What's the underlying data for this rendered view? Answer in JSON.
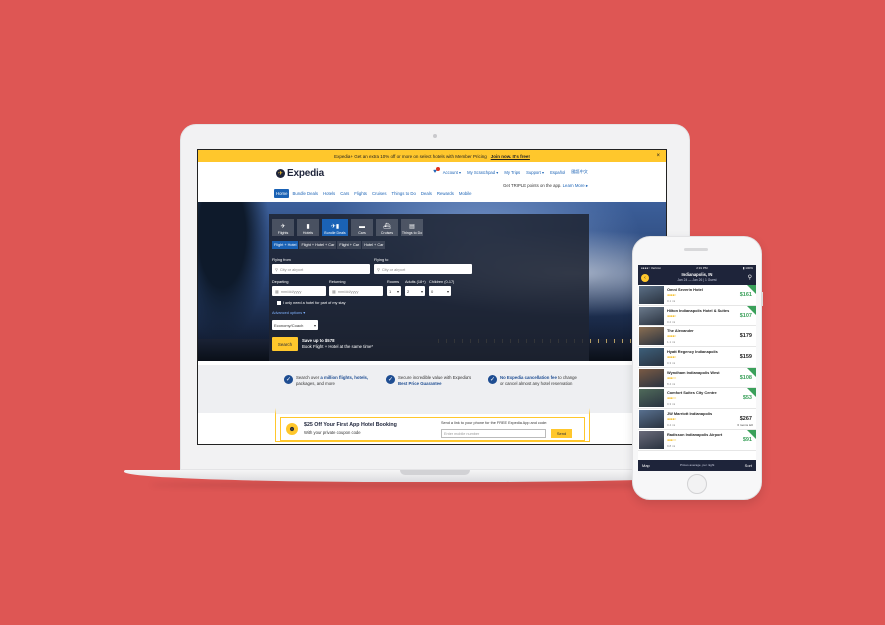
{
  "colors": {
    "background": "#de5654",
    "brand_navy": "#1e243a",
    "brand_yellow": "#ffc72c",
    "link_blue": "#1a62b5",
    "deal_green": "#3aa05a"
  },
  "laptop": {
    "promo_bar": {
      "text": "Expedia+  Get an extra 10% off or more on select hotels with Member Pricing",
      "link": "Join now. It's free!",
      "close": "×"
    },
    "logo": {
      "mark": "✈",
      "text": "Expedia"
    },
    "top_links": {
      "notification_icon": "bell-icon",
      "account": "Account ▾",
      "scratchpad": "My Scratchpad ▾",
      "trips": "My Trips",
      "support": "Support ▾",
      "lang1": "Español",
      "lang2": "國語中文"
    },
    "app_note": {
      "text": "Get TRIPLE points on the app.",
      "link": "Learn More ▸"
    },
    "nav": [
      "Home",
      "Bundle Deals",
      "Hotels",
      "Cars",
      "Flights",
      "Cruises",
      "Things to Do",
      "Deals",
      "Rewards",
      "Mobile"
    ],
    "search": {
      "tabs": [
        {
          "icon": "✈",
          "label": "Flights"
        },
        {
          "icon": "▮",
          "label": "Hotels"
        },
        {
          "icon": "✈▮",
          "label": "Bundle Deals"
        },
        {
          "icon": "▬",
          "label": "Cars"
        },
        {
          "icon": "⛴",
          "label": "Cruises"
        },
        {
          "icon": "▤",
          "label": "Things to Do"
        }
      ],
      "subtabs": [
        "Flight + Hotel",
        "Flight + Hotel + Car",
        "Flight + Car",
        "Hotel + Car"
      ],
      "flying_from_label": "Flying from",
      "flying_from_placeholder": "City or airport",
      "flying_to_label": "Flying to",
      "flying_to_placeholder": "City or airport",
      "departing_label": "Departing",
      "departing_placeholder": "mm/dd/yyyy",
      "returning_label": "Returning",
      "returning_placeholder": "mm/dd/yyyy",
      "rooms_label": "Rooms",
      "rooms_value": "1",
      "adults_label": "Adults (18+)",
      "adults_value": "2",
      "children_label": "Children (0-17)",
      "children_value": "0",
      "partial_hotel": "I only need a hotel for part of my stay",
      "advanced_options": "Advanced options ▾",
      "cabin_value": "Economy/Coach",
      "search_button": "Search",
      "save_title": "Save up to $578",
      "save_sub": "Book Flight + Hotel at the same time*"
    },
    "benefits": [
      {
        "pre": "Search over ",
        "bold": "a million flights, hotels,",
        "post": " packages, and more"
      },
      {
        "pre": "Secure incredible value with Expedia's ",
        "bold": "Best Price Guarantee",
        "post": ""
      },
      {
        "pre": "",
        "bold": "No Expedia cancellation fee",
        "post": " to change or cancel almost any hotel reservation"
      }
    ],
    "app_promo": {
      "icon": "☻",
      "title": "$25 Off Your First App Hotel Booking",
      "subtitle": "With your private coupon code",
      "sms_label": "Send a link to your phone for the FREE Expedia App and code:",
      "sms_placeholder": "Enter mobile number",
      "send_button": "Send"
    }
  },
  "phone": {
    "status": {
      "carrier": "●●●●○ Verizon",
      "time": "2:31 PM",
      "battery": "▮ 100%"
    },
    "city": "Indianapolis, IN",
    "dates": "Jan 24 — Jan 26  |  1 Guest",
    "hotels": [
      {
        "name": "Omni Severin Hotel",
        "stars": "●●●●○",
        "distance": "0.1 mi",
        "price": "$161",
        "deal": true,
        "note": ""
      },
      {
        "name": "Hilton Indianapolis Hotel & Suites",
        "stars": "●●●●○",
        "distance": "0.2 mi",
        "price": "$107",
        "deal": true,
        "note": ""
      },
      {
        "name": "The Alexander",
        "stars": "●●●●○",
        "distance": "1.1 mi",
        "price": "$179",
        "deal": false,
        "note": ""
      },
      {
        "name": "Hyatt Regency Indianapolis",
        "stars": "●●●●○",
        "distance": "0.3 mi",
        "price": "$159",
        "deal": false,
        "note": ""
      },
      {
        "name": "Wyndham Indianapolis West",
        "stars": "●●●○○",
        "distance": "8.4 mi",
        "price": "$108",
        "deal": true,
        "note": ""
      },
      {
        "name": "Comfort Suites City Centre",
        "stars": "●●●○○",
        "distance": "0.3 mi",
        "price": "$53",
        "deal": true,
        "note": ""
      },
      {
        "name": "JW Marriott Indianapolis",
        "stars": "●●●●○",
        "distance": "0.4 mi",
        "price": "$267",
        "deal": false,
        "note": "6 rooms left"
      },
      {
        "name": "Radisson Indianapolis Airport",
        "stars": "●●●○○",
        "distance": "9.8 mi",
        "price": "$91",
        "deal": true,
        "note": ""
      }
    ],
    "bottom": {
      "map": "Map",
      "note": "Prices average, per night",
      "sort": "Sort"
    }
  }
}
